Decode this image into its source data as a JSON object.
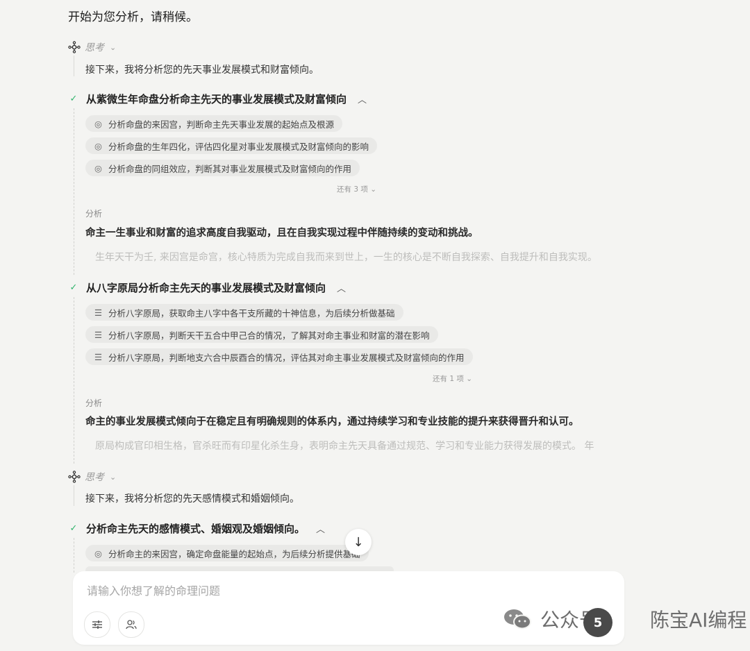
{
  "intro_text": "开始为您分析，请稍候。",
  "think_label": "思考",
  "think1_text": "接下来，我将分析您的先天事业发展模式和财富倾向。",
  "step1": {
    "title": "从紫微生年命盘分析命主先天的事业发展模式及财富倾向",
    "items": [
      "分析命盘的来因宫，判断命主先天事业发展的起始点及根源",
      "分析命盘的生年四化，评估四化星对事业发展模式及财富倾向的影响",
      "分析命盘的同组效应，判断其对事业发展模式及财富倾向的作用"
    ],
    "more": "还有 3 项",
    "analysis_label": "分析",
    "analysis_bold": "命主一生事业和财富的追求高度自我驱动，且在自我实现过程中伴随持续的变动和挑战。",
    "analysis_faded": "生年天干为壬, 来因宫是命宫，核心特质为完成自我而来到世上，一生的核心是不断自我探索、自我提升和自我实现。"
  },
  "step2": {
    "title": "从八字原局分析命主先天的事业发展模式及财富倾向",
    "items": [
      "分析八字原局，获取命主八字中各干支所藏的十神信息，为后续分析做基础",
      "分析八字原局，判断天干五合中甲己合的情况，了解其对命主事业和财富的潜在影响",
      "分析八字原局，判断地支六合中辰酉合的情况，评估其对命主事业发展模式及财富倾向的作用"
    ],
    "more": "还有 1 项",
    "analysis_label": "分析",
    "analysis_bold": "命主的事业发展模式倾向于在稳定且有明确规则的体系内，通过持续学习和专业技能的提升来获得晋升和认可。",
    "analysis_faded": "原局构成官印相生格，官杀旺而有印星化杀生身，表明命主先天具备通过规范、学习和专业能力获得发展的模式。 年"
  },
  "think2_text": "接下来，我将分析您的先天感情模式和婚姻倾向。",
  "step3": {
    "title": "分析命主先天的感情模式、婚姻观及婚姻倾向。",
    "items": [
      "分析命主的来因宫，确定命盘能量的起始点，为后续分析提供基础"
    ]
  },
  "input": {
    "placeholder": "请输入你想了解的命理问题"
  },
  "watermark": {
    "text1": "公众号",
    "text2": "陈宝AI编程",
    "badge": "5"
  },
  "icons": {
    "think": "branch-node-icon",
    "check": "check-icon",
    "target": "target-icon",
    "list": "list-icon",
    "scroll": "arrow-down-icon",
    "settings": "sliders-icon",
    "people": "people-icon",
    "wechat": "wechat-icon"
  },
  "colors": {
    "check_green": "#2fb36b",
    "background": "#f4f4f2"
  }
}
